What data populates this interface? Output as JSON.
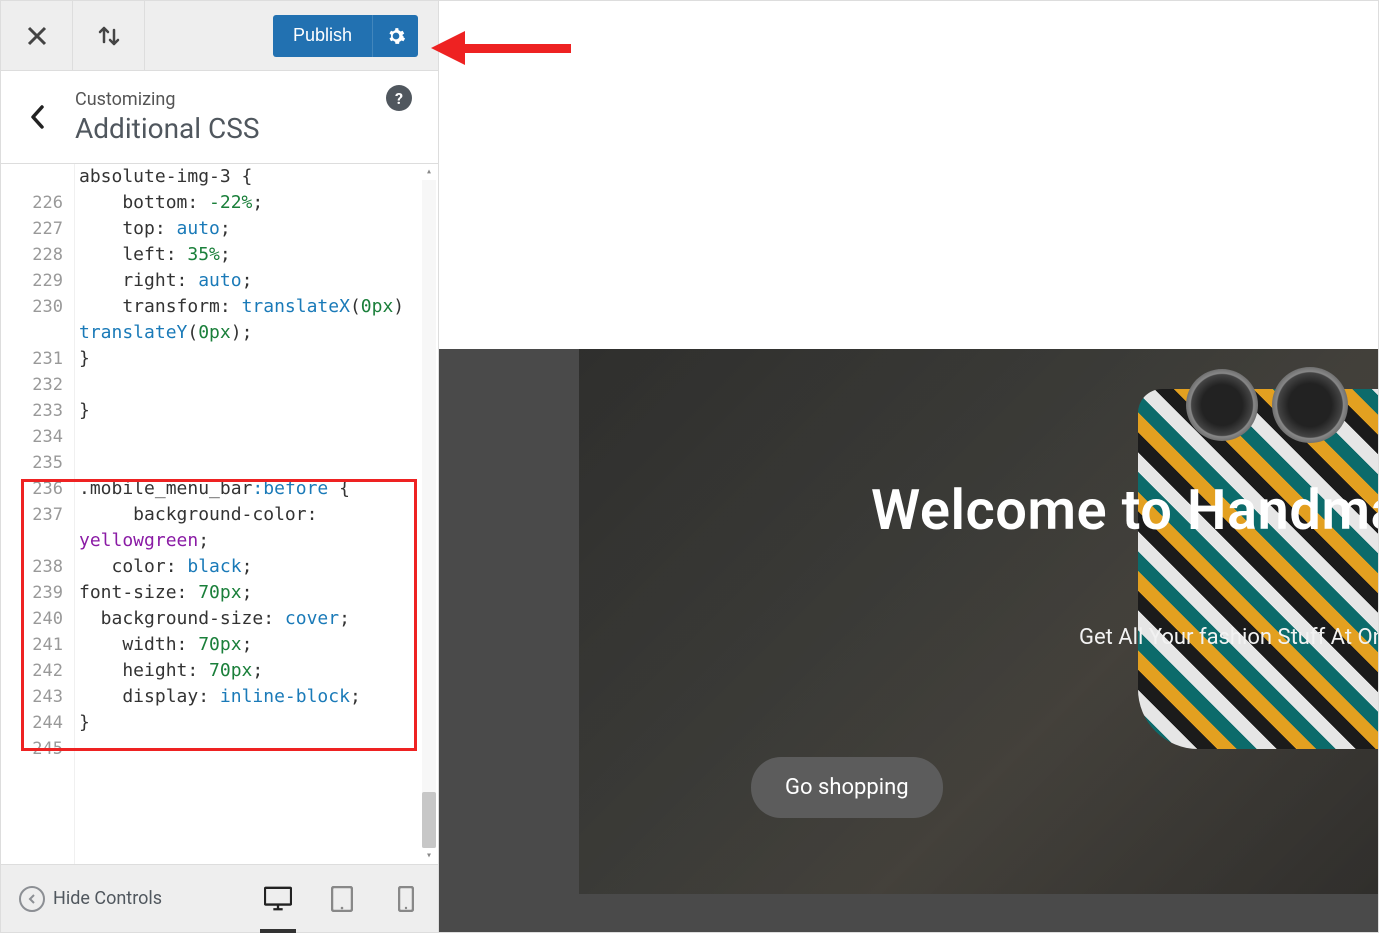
{
  "topbar": {
    "publish_label": "Publish"
  },
  "header": {
    "eyebrow": "Customizing",
    "title": "Additional CSS",
    "help": "?"
  },
  "code": {
    "lines": [
      {
        "n": "",
        "frags": [
          {
            "t": "absolute-img-3 {",
            "c": "t-sel"
          }
        ]
      },
      {
        "n": "226",
        "frags": [
          {
            "t": "    bottom: ",
            "c": "t-prop"
          },
          {
            "t": "-22%",
            "c": "t-num"
          },
          {
            "t": ";",
            "c": "t-sel"
          }
        ]
      },
      {
        "n": "227",
        "frags": [
          {
            "t": "    top: ",
            "c": "t-prop"
          },
          {
            "t": "auto",
            "c": "t-val"
          },
          {
            "t": ";",
            "c": "t-sel"
          }
        ]
      },
      {
        "n": "228",
        "frags": [
          {
            "t": "    left: ",
            "c": "t-prop"
          },
          {
            "t": "35%",
            "c": "t-num"
          },
          {
            "t": ";",
            "c": "t-sel"
          }
        ]
      },
      {
        "n": "229",
        "frags": [
          {
            "t": "    right: ",
            "c": "t-prop"
          },
          {
            "t": "auto",
            "c": "t-val"
          },
          {
            "t": ";",
            "c": "t-sel"
          }
        ]
      },
      {
        "n": "230",
        "frags": [
          {
            "t": "    transform: ",
            "c": "t-prop"
          },
          {
            "t": "translateX",
            "c": "t-val"
          },
          {
            "t": "(",
            "c": "t-sel"
          },
          {
            "t": "0px",
            "c": "t-num"
          },
          {
            "t": ") ",
            "c": "t-sel"
          }
        ]
      },
      {
        "n": "",
        "frags": [
          {
            "t": "translateY",
            "c": "t-val"
          },
          {
            "t": "(",
            "c": "t-sel"
          },
          {
            "t": "0px",
            "c": "t-num"
          },
          {
            "t": ");",
            "c": "t-sel"
          }
        ]
      },
      {
        "n": "231",
        "frags": [
          {
            "t": "}",
            "c": "t-sel"
          }
        ]
      },
      {
        "n": "232",
        "frags": [
          {
            "t": "",
            "c": "t-sel"
          }
        ]
      },
      {
        "n": "233",
        "frags": [
          {
            "t": "}",
            "c": "t-sel"
          }
        ]
      },
      {
        "n": "234",
        "frags": [
          {
            "t": "",
            "c": "t-sel"
          }
        ]
      },
      {
        "n": "235",
        "frags": [
          {
            "t": "",
            "c": "t-sel"
          }
        ]
      },
      {
        "n": "236",
        "frags": [
          {
            "t": ".mobile_menu_bar",
            "c": "t-sel"
          },
          {
            "t": ":before",
            "c": "t-pseudo"
          },
          {
            "t": " {",
            "c": "t-sel"
          }
        ]
      },
      {
        "n": "237",
        "frags": [
          {
            "t": "     background-color:",
            "c": "t-prop"
          }
        ]
      },
      {
        "n": "",
        "frags": [
          {
            "t": "yellowgreen",
            "c": "t-kw"
          },
          {
            "t": ";",
            "c": "t-sel"
          }
        ]
      },
      {
        "n": "238",
        "frags": [
          {
            "t": "   color: ",
            "c": "t-prop"
          },
          {
            "t": "black",
            "c": "t-val"
          },
          {
            "t": ";",
            "c": "t-sel"
          }
        ]
      },
      {
        "n": "239",
        "frags": [
          {
            "t": "font-size: ",
            "c": "t-prop"
          },
          {
            "t": "70px",
            "c": "t-num"
          },
          {
            "t": ";",
            "c": "t-sel"
          }
        ]
      },
      {
        "n": "240",
        "frags": [
          {
            "t": "  background-size: ",
            "c": "t-prop"
          },
          {
            "t": "cover",
            "c": "t-val"
          },
          {
            "t": ";",
            "c": "t-sel"
          }
        ]
      },
      {
        "n": "241",
        "frags": [
          {
            "t": "    width: ",
            "c": "t-prop"
          },
          {
            "t": "70px",
            "c": "t-num"
          },
          {
            "t": ";",
            "c": "t-sel"
          }
        ]
      },
      {
        "n": "242",
        "frags": [
          {
            "t": "    height: ",
            "c": "t-prop"
          },
          {
            "t": "70px",
            "c": "t-num"
          },
          {
            "t": ";",
            "c": "t-sel"
          }
        ]
      },
      {
        "n": "243",
        "frags": [
          {
            "t": "    display: ",
            "c": "t-prop"
          },
          {
            "t": "inline-block",
            "c": "t-val"
          },
          {
            "t": ";",
            "c": "t-sel"
          }
        ]
      },
      {
        "n": "244",
        "frags": [
          {
            "t": "}",
            "c": "t-sel"
          }
        ]
      },
      {
        "n": "245",
        "frags": [
          {
            "t": "",
            "c": "t-sel"
          }
        ]
      }
    ]
  },
  "bottombar": {
    "hide_controls": "Hide Controls"
  },
  "preview": {
    "hero_title": "Welcome to Handmade",
    "hero_sub": "Get All Your fashion Stuff At One Place",
    "cta": "Go shopping"
  },
  "colors": {
    "accent": "#2271b1",
    "annotation": "#e22"
  }
}
